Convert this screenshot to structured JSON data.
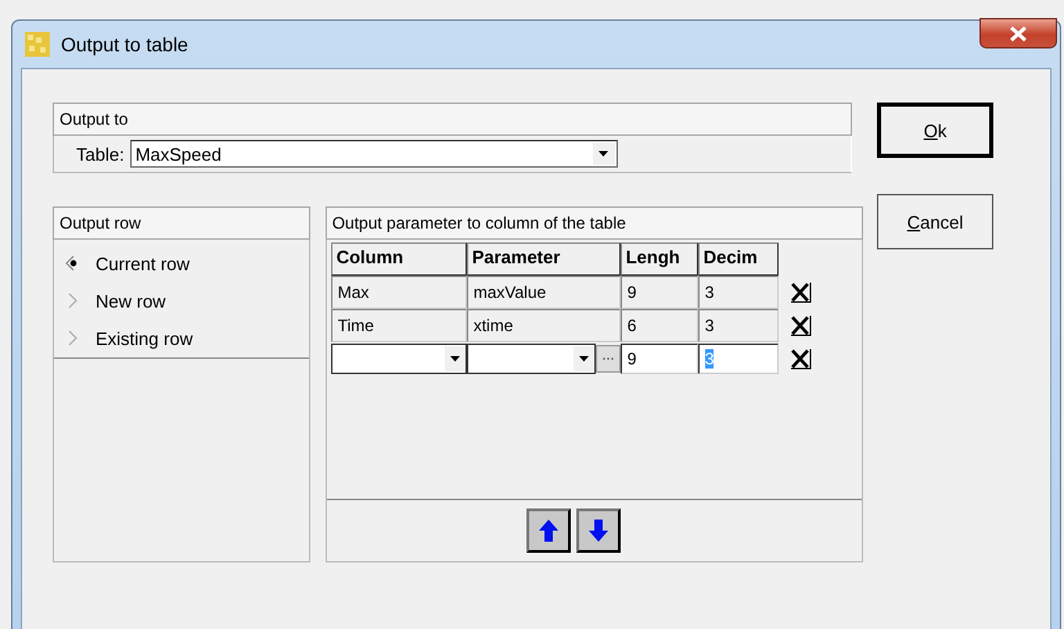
{
  "window": {
    "title": "Output to table"
  },
  "output_to": {
    "title": "Output to",
    "table_label": "Table:",
    "table_value": "MaxSpeed"
  },
  "buttons": [
    {
      "label": "Ok",
      "default": true
    },
    {
      "label": "Cancel",
      "default": false
    }
  ],
  "output_row": {
    "title": "Output row",
    "options": [
      {
        "label": "Current row",
        "selected": true
      },
      {
        "label": "New row",
        "selected": false
      },
      {
        "label": "Existing row",
        "selected": false
      }
    ]
  },
  "parameters": {
    "title": "Output parameter to column of the table",
    "columns": [
      "Column",
      "Parameter",
      "Lengh",
      "Decim"
    ],
    "rows": [
      {
        "kind": "text",
        "column": "Max",
        "parameter": "maxValue",
        "length": "9",
        "decimals": "3",
        "decimals_selected": false
      },
      {
        "kind": "text",
        "column": "Time",
        "parameter": "xtime",
        "length": "6",
        "decimals": "3",
        "decimals_selected": false
      },
      {
        "kind": "editor",
        "column": "",
        "parameter": "",
        "length": "9",
        "decimals": "3",
        "decimals_selected": true
      }
    ]
  }
}
